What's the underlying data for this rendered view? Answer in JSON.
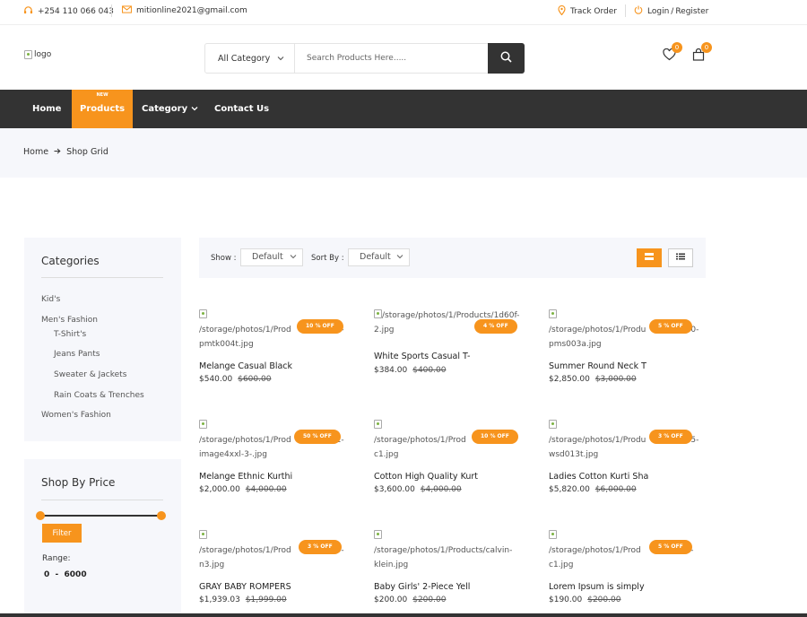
{
  "topbar": {
    "phone": "+254 110 066 043",
    "email": "mitionline2021@gmail.com",
    "track_order": "Track Order",
    "login": "Login",
    "login_sep": "/",
    "register": "Register"
  },
  "header": {
    "logo_alt": "logo",
    "category_select": "All Category",
    "search_placeholder": "Search Products Here.....",
    "wishlist_count": "0",
    "cart_count": "0"
  },
  "nav": {
    "home": "Home",
    "products": "Products",
    "new_tag": "NEW",
    "category": "Category",
    "contact": "Contact Us"
  },
  "breadcrumb": {
    "home": "Home",
    "current": "Shop Grid"
  },
  "sidebar": {
    "categories_title": "Categories",
    "categories": [
      {
        "label": "Kid's"
      },
      {
        "label": "Men's Fashion"
      },
      {
        "label": "T-Shirt's"
      },
      {
        "label": "Jeans Pants"
      },
      {
        "label": "Sweater & Jackets"
      },
      {
        "label": "Rain Coats & Trenches"
      },
      {
        "label": "Women's Fashion"
      }
    ],
    "price_title": "Shop By Price",
    "filter_label": "Filter",
    "range_label": "Range:",
    "range_value": "0  -  6000"
  },
  "toolbar": {
    "show_label": "Show :",
    "show_value": "Default",
    "sort_label": "Sort By :",
    "sort_value": "Default"
  },
  "products": [
    {
      "img": "/storage/photos/1/Products/...7-pmtk004t.jpg",
      "img_a": "/storage/photos/1/Prod",
      "img_b": "7-",
      "img_c": "pmtk004t.jpg",
      "sale": "10 % OFF",
      "title": "Melange Casual Black",
      "price": "$540.00",
      "old": "$600.00"
    },
    {
      "img": "/storage/photos/1/Products/1d60f-2.jpg",
      "img_a": "/storage/photos/1/Products/1d60f-",
      "img_b": "",
      "img_c": "2.jpg",
      "sale": "4 % OFF",
      "title": "White Sports Casual T-",
      "price": "$384.00",
      "old": "$400.00"
    },
    {
      "img": "/storage/photos/1/Products/...0-pms003a.jpg",
      "img_a": "/storage/photos/1/Produ",
      "img_b": "0-",
      "img_c": "pms003a.jpg",
      "sale": "5 % OFF",
      "title": "Summer Round Neck T",
      "price": "$2,850.00",
      "old": "$3,000.00"
    },
    {
      "img": "/storage/photos/1/Products/...2-image4xxl-3-.jpg",
      "img_a": "/storage/photos/1/Prod",
      "img_b": "2-",
      "img_c": "image4xxl-3-.jpg",
      "sale": "50 % OFF",
      "title": "Melange Ethnic Kurthi",
      "price": "$2,000.00",
      "old": "$4,000.00"
    },
    {
      "img": "/storage/photos/1/Products/...-c1.jpg",
      "img_a": "/storage/photos/1/Prod",
      "img_b": "",
      "img_c": "c1.jpg",
      "sale": "10 % OFF",
      "title": "Cotton High Quality Kurt",
      "price": "$3,600.00",
      "old": "$4,000.00"
    },
    {
      "img": "/storage/photos/1/Products/...5-wsd013t.jpg",
      "img_a": "/storage/photos/1/Produ",
      "img_b": "5-",
      "img_c": "wsd013t.jpg",
      "sale": "3 % OFF",
      "title": "Ladies Cotton Kurti Sha",
      "price": "$5,820.00",
      "old": "$6,000.00"
    },
    {
      "img": "/storage/photos/1/Products/...9-n3.jpg",
      "img_a": "/storage/photos/1/Prod",
      "img_b": "9-",
      "img_c": "n3.jpg",
      "sale": "3 % OFF",
      "title": "GRAY BABY ROMPERS",
      "price": "$1,939.03",
      "old": "$1,999.00"
    },
    {
      "img": "/storage/photos/1/Products/calvin-klein.jpg",
      "img_a": "/storage/photos/1/Products/calvin-",
      "img_b": "",
      "img_c": "klein.jpg",
      "sale": "",
      "title": "Baby Girls' 2-Piece Yell",
      "price": "$200.00",
      "old": "$200.00"
    },
    {
      "img": "/storage/photos/1/Products/...e-c1.jpg",
      "img_a": "/storage/photos/1/Prod",
      "img_b": "e-",
      "img_c": "c1.jpg",
      "sale": "5 % OFF",
      "title": "Lorem Ipsum is simply",
      "price": "$190.00",
      "old": "$200.00"
    }
  ],
  "colors": {
    "accent": "#f7941d",
    "dark": "#333333",
    "panel": "#f6f7fb"
  }
}
